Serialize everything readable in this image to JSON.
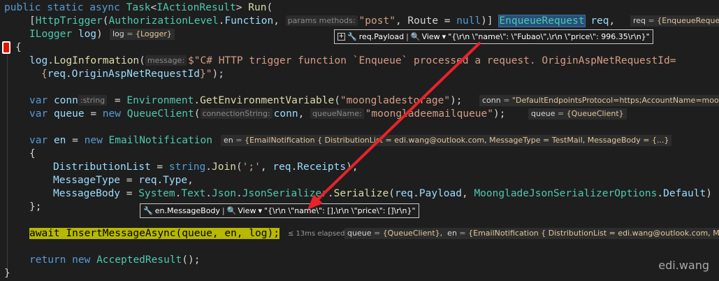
{
  "code": {
    "l1": {
      "kw": "public static async ",
      "type": "Task",
      "p1": "<",
      "type2": "IActionResult",
      "p2": "> ",
      "method": "Run",
      "p3": "("
    },
    "l2": {
      "p1": "[",
      "type": "HttpTrigger",
      "p2": "(",
      "type2": "AuthorizationLevel",
      "p3": ".",
      "var": "Function",
      "p4": ", ",
      "inlay": "params methods:",
      "str": "\"post\"",
      "p5": ", Route = ",
      "kw": "null",
      "p6": ")] ",
      "sel": "EnqueueRequest",
      "p7": " ",
      "var2": "req",
      "p8": ","
    },
    "l3": {
      "type": "ILogger",
      "p1": " ",
      "var": "log",
      "p2": ")"
    },
    "l4": {
      "p": "{"
    },
    "l5": {
      "var": "log",
      "p1": ".",
      "method": "LogInformation",
      "p2": "(",
      "inlay": "message:",
      "str": "$\"C# HTTP trigger function `Enqueue` processed a request. OriginAspNetRequestId="
    },
    "l6": {
      "p1": "{",
      "var": "req",
      "p2": ".",
      "var2": "OriginAspNetRequestId",
      "p3": "}",
      "str": "\"",
      "p4": ");"
    },
    "l7": {
      "kw": "var",
      "p0": " ",
      "var": "conn",
      "inlay": ":string",
      "p1": " = ",
      "type": "Environment",
      "p2": ".",
      "method": "GetEnvironmentVariable",
      "p3": "(",
      "str": "\"moongladestorage\"",
      "p4": ");"
    },
    "l8": {
      "kw": "var",
      "p0": " ",
      "var": "queue",
      "p1": " = ",
      "kw2": "new",
      "p2": " ",
      "type": "QueueClient",
      "p3": "(",
      "inlay": "connectionString:",
      "var2": "conn",
      "p4": ", ",
      "inlay2": "queueName:",
      "str": "\"moongladeemailqueue\"",
      "p5": ");"
    },
    "l9": {
      "kw": "var",
      "p0": " ",
      "var": "en",
      "p1": " = ",
      "kw2": "new",
      "p2": " ",
      "type": "EmailNotification"
    },
    "l10": {
      "p": "{"
    },
    "l11": {
      "var": "DistributionList",
      "p1": " = ",
      "kw": "string",
      "p2": ".",
      "method": "Join",
      "p3": "(",
      "str": "';'",
      "p4": ", ",
      "var2": "req",
      "p5": ".",
      "var3": "Receipts",
      "p6": "),"
    },
    "l12": {
      "var": "MessageType",
      "p1": " = ",
      "var2": "req",
      "p2": ".",
      "var3": "Type",
      "p3": ","
    },
    "l13": {
      "var": "MessageBody",
      "p1": " = ",
      "type": "System",
      "p2": ".",
      "type2": "Text",
      "p3": ".",
      "type3": "Json",
      "p4": ".",
      "type4": "JsonSerializer",
      "p5": ".",
      "method": "Serialize",
      "p6": "(",
      "var2": "req",
      "p7": ".",
      "var3": "Payload",
      "p8": ", ",
      "type5": "MoongladeJsonSerializerOptions",
      "p9": ".",
      "var4": "Default",
      "p10": ")"
    },
    "l14": {
      "p": "};"
    },
    "l15": {
      "hl": "await InsertMessageAsync(queue, en, log);"
    },
    "l16": {
      "kw": "return",
      "p1": " ",
      "kw2": "new",
      "p2": " ",
      "type": "AcceptedResult",
      "p3": "();"
    },
    "l17": {
      "p": "}"
    }
  },
  "hints": {
    "req": {
      "name": "req",
      "eq": " = ",
      "val": "{EnqueueRequest"
    },
    "log": {
      "name": "log",
      "eq": " = ",
      "val": "{Logger}"
    },
    "conn": {
      "name": "conn",
      "eq": " = ",
      "val": "\"DefaultEndpointsProtocol=https;AccountName=moong"
    },
    "queue": {
      "name": "queue",
      "eq": " = ",
      "val": "{QueueClient}"
    },
    "en": {
      "name": "en",
      "eq": " = ",
      "val": "{EmailNotification { DistributionList = edi.wang@outlook.com, MessageType = TestMail, MessageBody = {...}"
    },
    "last": {
      "elapsed": "≤ 13ms elapsed",
      "queue_name": "queue",
      "queue_eq": " = ",
      "queue_val": "{QueueClient},",
      "en_name": "en",
      "en_eq": " = ",
      "en_val": "{EmailNotification { DistributionList = edi.wang@outlook.com, Messag"
    }
  },
  "datatips": {
    "payload": {
      "expand": "+",
      "name": "req.Payload",
      "view": "View",
      "value": "\"{\\r\\n  \\\"name\\\": \\\"Fubao\\\",\\r\\n  \\\"price\\\": 996.35\\r\\n}\""
    },
    "body": {
      "name": "en.MessageBody",
      "view": "View",
      "value": "\"{\\r\\n  \\\"name\\\": [],\\r\\n  \\\"price\\\": []\\r\\n}\""
    }
  },
  "watermark": "edi.wang",
  "colors": {
    "arrow": "#e8232a",
    "highlight": "#b8b800",
    "selection": "#264f78"
  }
}
